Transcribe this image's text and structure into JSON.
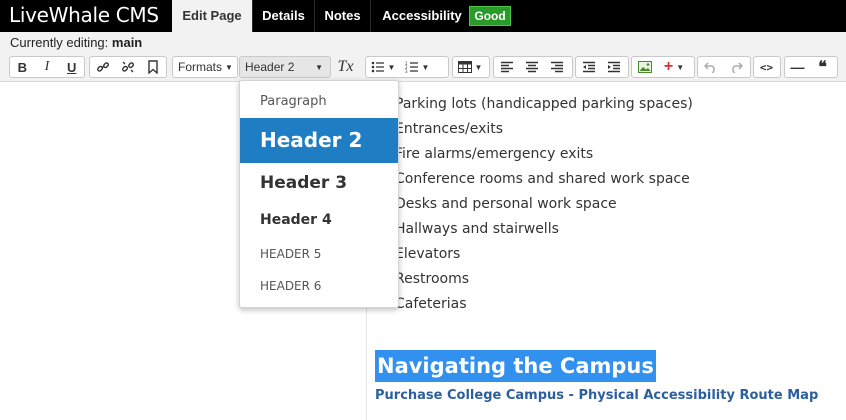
{
  "app": {
    "logo": "LiveWhale CMS"
  },
  "tabs": [
    {
      "label": "Edit Page"
    },
    {
      "label": "Details"
    },
    {
      "label": "Notes"
    },
    {
      "label": "Accessibility",
      "badge": "Good"
    }
  ],
  "editing": {
    "prefix": "Currently editing:",
    "name": "main"
  },
  "toolbar": {
    "bold": "B",
    "italic": "I",
    "underline": "U",
    "formats_label": "Formats",
    "block_format_value": "Header 2",
    "clear_format": "Tx",
    "source_code": "<>",
    "hr": "—",
    "blockquote": "❝"
  },
  "dropdown": {
    "options": [
      "Paragraph",
      "Header 2",
      "Header 3",
      "Header 4",
      "HEADER 5",
      "HEADER 6"
    ],
    "selected": "Header 2"
  },
  "content": {
    "list": [
      "Parking lots (handicapped parking spaces)",
      "Entrances/exits",
      "Fire alarms/emergency exits",
      "Conference rooms and shared work space",
      "Desks and personal work space",
      "Hallways and stairwells",
      "Elevators",
      "Restrooms",
      "Cafeterias"
    ],
    "heading": "Navigating the Campus",
    "link": "Purchase College Campus - Physical Accessibility Route Map"
  },
  "colors": {
    "topbar": "#000000",
    "badge": "#2a9a2a",
    "selection": "#3290ee",
    "dropdown_active": "#1f7dc4",
    "link": "#2b5f9e"
  }
}
